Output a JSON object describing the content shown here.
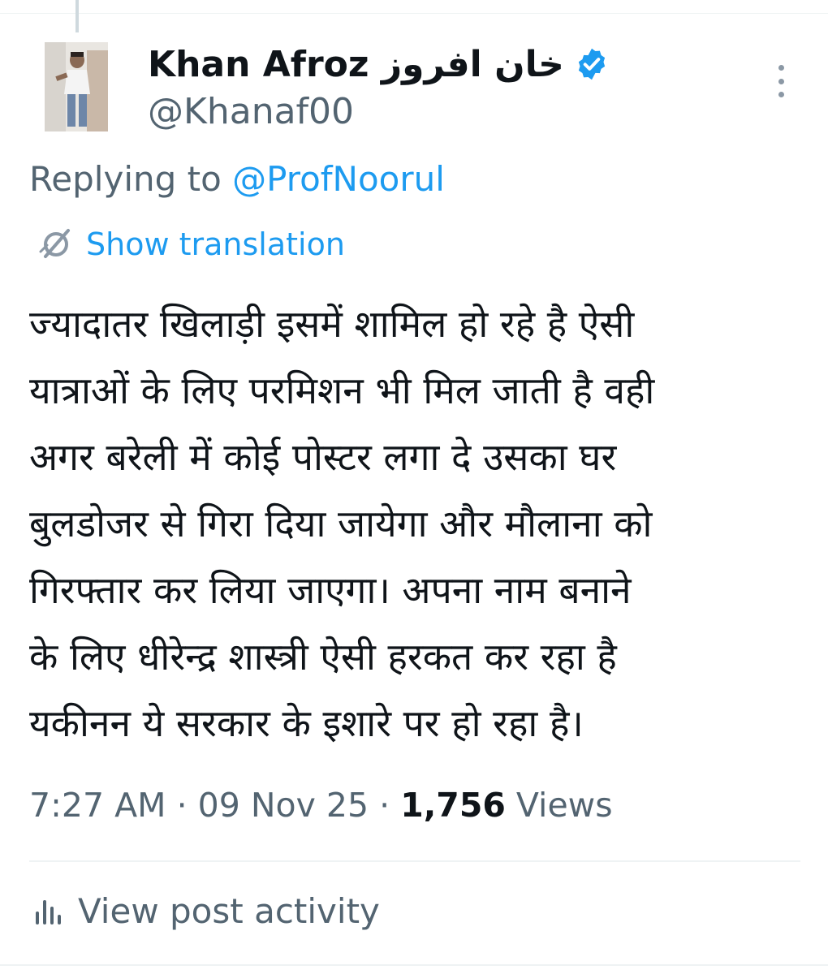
{
  "author": {
    "display_name": "Khan Afroz خان افروز",
    "handle": "@Khanaf00",
    "verified": true,
    "avatar_icon": "profile-photo"
  },
  "reply": {
    "prefix": "Replying to ",
    "target": "@ProfNoorul"
  },
  "translation": {
    "label": "Show translation",
    "icon": "translate-icon"
  },
  "tweet": {
    "lines": [
      "ज्यादातर खिलाड़ी इसमें शामिल हो रहे है ऐसी",
      "यात्राओं के लिए परमिशन भी मिल जाती है वही",
      "अगर बरेली में कोई पोस्टर लगा दे उसका घर",
      "बुलडोजर से गिरा दिया जायेगा और मौलाना को",
      "गिरफ्तार कर लिया जाएगा। अपना नाम बनाने",
      "के लिए धीरेन्द्र शास्त्री ऐसी हरकत कर रहा है",
      "यकीनन ये सरकार के इशारे पर हो रहा है।"
    ]
  },
  "meta": {
    "time": "7:27 AM",
    "separator": " · ",
    "date": "09 Nov 25",
    "views_count": "1,756",
    "views_label": " Views"
  },
  "activity": {
    "label": "View post activity",
    "icon": "bar-chart-icon"
  },
  "colors": {
    "accent": "#1d9bf0",
    "text_primary": "#0f1419",
    "text_secondary": "#536471",
    "divider": "#eff3f4"
  }
}
